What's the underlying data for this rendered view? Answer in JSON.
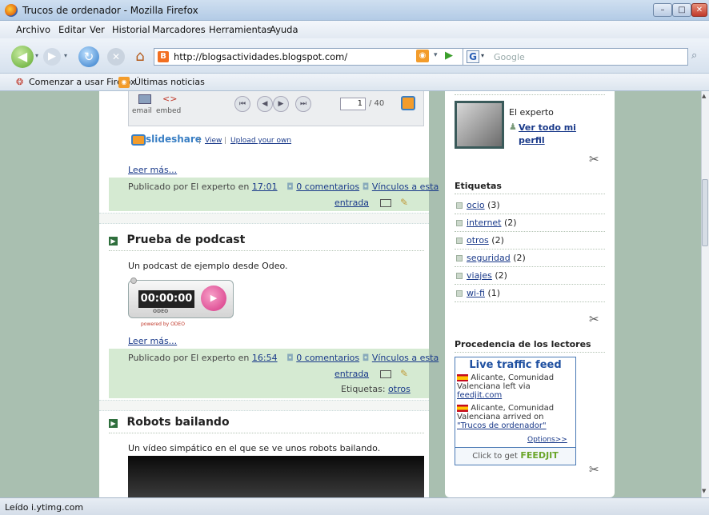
{
  "window": {
    "title": "Trucos de ordenador - Mozilla Firefox",
    "minimize": "–",
    "maximize": "□",
    "close": "✕"
  },
  "menu": [
    "Archivo",
    "Editar",
    "Ver",
    "Historial",
    "Marcadores",
    "Herramientas",
    "Ayuda"
  ],
  "nav": {
    "url": "http://blogsactividades.blogspot.com/",
    "search_placeholder": "Google",
    "search_engine_letter": "G"
  },
  "bookmarks": [
    "Comenzar a usar Firefox",
    "Últimas noticias"
  ],
  "slideshare": {
    "email": "email",
    "embed": "embed",
    "page_current": "1",
    "page_total": "/ 40",
    "brand": "slideshare",
    "view": "View",
    "upload": "Upload your own"
  },
  "posts": [
    {
      "read_more": "Leer más...",
      "footer_prefix": "Publicado por El experto en",
      "time": "17:01",
      "comments": "0 comentarios",
      "links": "Vínculos a esta",
      "entry": "entrada"
    },
    {
      "title": "Prueba de podcast",
      "body": "Un podcast de ejemplo desde Odeo.",
      "player_time": "00:00:00",
      "player_brand": "ODEO",
      "powered": "powered by ODEO",
      "read_more": "Leer más...",
      "footer_prefix": "Publicado por El experto en",
      "time": "16:54",
      "comments": "0 comentarios",
      "links": "Vínculos a esta",
      "entry": "entrada",
      "tags_label": "Etiquetas:",
      "tag": "otros"
    },
    {
      "title": "Robots bailando",
      "body": "Un vídeo simpático en el que se ve unos robots bailando."
    }
  ],
  "profile": {
    "name": "El experto",
    "see_profile": "Ver todo mi perfil"
  },
  "labels": {
    "heading": "Etiquetas",
    "items": [
      {
        "name": "ocio",
        "count": "(3)"
      },
      {
        "name": "internet",
        "count": "(2)"
      },
      {
        "name": "otros",
        "count": "(2)"
      },
      {
        "name": "seguridad",
        "count": "(2)"
      },
      {
        "name": "viajes",
        "count": "(2)"
      },
      {
        "name": "wi-fi",
        "count": "(1)"
      }
    ]
  },
  "readers": {
    "heading": "Procedencia de los lectores",
    "feed_title": "Live traffic feed",
    "entry1_a": "Alicante, Comunidad",
    "entry1_b": "Valenciana left via",
    "entry1_link": "feedjit.com",
    "entry2_a": "Alicante, Comunidad",
    "entry2_b": "Valenciana arrived on",
    "entry2_link": "\"Trucos de ordenador\"",
    "options": "Options>>",
    "click_to_get": "Click to get",
    "feedjit": "FEEDJIT"
  },
  "status": "Leído i.ytimg.com",
  "colors": {
    "page_bg": "#a9bfb0",
    "post_footer": "#d5ead2",
    "link": "#1a3a8a"
  }
}
